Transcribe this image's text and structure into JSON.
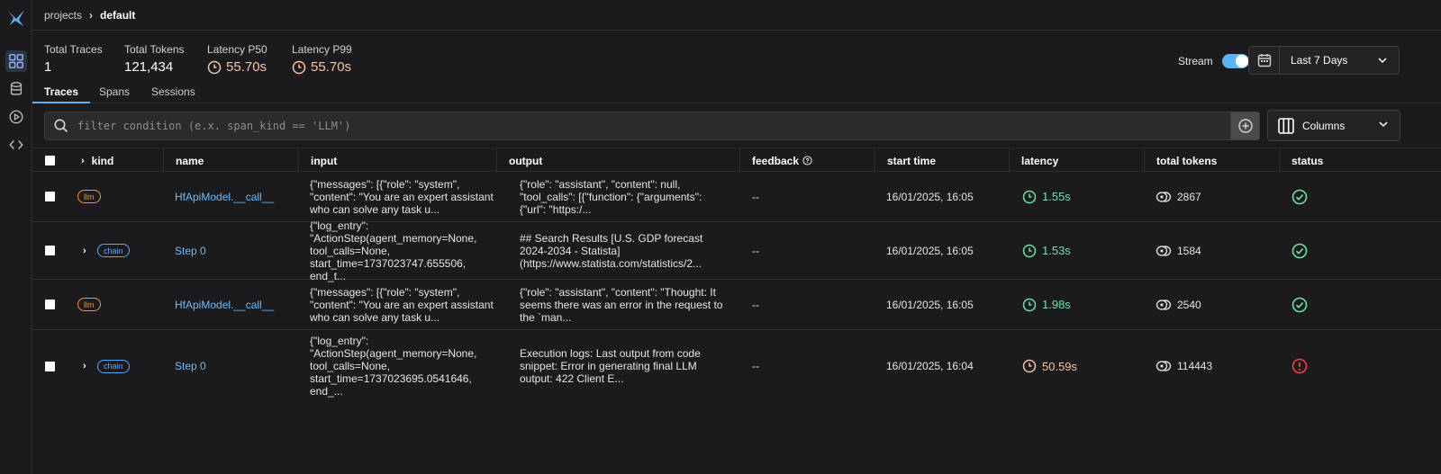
{
  "breadcrumb": {
    "parent": "projects",
    "current": "default"
  },
  "stats": [
    {
      "label": "Total Traces",
      "value": "1"
    },
    {
      "label": "Total Tokens",
      "value": "121,434"
    },
    {
      "label": "Latency P50",
      "value": "55.70s"
    },
    {
      "label": "Latency P99",
      "value": "55.70s"
    }
  ],
  "stream": {
    "label": "Stream",
    "enabled": true
  },
  "time_range": {
    "value": "Last 7 Days"
  },
  "tabs": [
    {
      "label": "Traces",
      "active": true
    },
    {
      "label": "Spans",
      "active": false
    },
    {
      "label": "Sessions",
      "active": false
    }
  ],
  "filter": {
    "placeholder": "filter condition (e.x. span_kind == 'LLM')"
  },
  "columns_button": {
    "label": "Columns"
  },
  "table": {
    "headers": {
      "kind": "kind",
      "name": "name",
      "input": "input",
      "output": "output",
      "feedback": "feedback",
      "start_time": "start time",
      "latency": "latency",
      "total_tokens": "total tokens",
      "status": "status"
    },
    "rows": [
      {
        "kind": "llm",
        "expandable": false,
        "name": "HfApiModel.__call__",
        "input": "{\"messages\": [{\"role\": \"system\", \"content\": \"You are an expert assistant who can solve any task u...",
        "output": "{\"role\": \"assistant\", \"content\": null, \"tool_calls\": [{\"function\": {\"arguments\": {\"url\": \"https:/...",
        "feedback": "--",
        "start_time": "16/01/2025, 16:05",
        "latency": "1.55s",
        "latency_state": "ok",
        "total_tokens": "2867",
        "status": "ok"
      },
      {
        "kind": "chain",
        "expandable": true,
        "name": "Step 0",
        "input": "{\"log_entry\": \"ActionStep(agent_memory=None, tool_calls=None, start_time=1737023747.655506, end_t...",
        "output": "## Search Results [U.S. GDP forecast 2024-2034 - Statista] (https://www.statista.com/statistics/2...",
        "feedback": "--",
        "start_time": "16/01/2025, 16:05",
        "latency": "1.53s",
        "latency_state": "ok",
        "total_tokens": "1584",
        "status": "ok"
      },
      {
        "kind": "llm",
        "expandable": false,
        "name": "HfApiModel.__call__",
        "input": "{\"messages\": [{\"role\": \"system\", \"content\": \"You are an expert assistant who can solve any task u...",
        "output": "{\"role\": \"assistant\", \"content\": \"Thought: It seems there was an error in the request to the `man...",
        "feedback": "--",
        "start_time": "16/01/2025, 16:05",
        "latency": "1.98s",
        "latency_state": "ok",
        "total_tokens": "2540",
        "status": "ok"
      },
      {
        "kind": "chain",
        "expandable": true,
        "name": "Step 0",
        "input": "{\"log_entry\": \"ActionStep(agent_memory=None, tool_calls=None, start_time=1737023695.0541646, end_...",
        "output": "Execution logs: Last output from code snippet: Error in generating final LLM output: 422 Client E...",
        "feedback": "--",
        "start_time": "16/01/2025, 16:04",
        "latency": "50.59s",
        "latency_state": "warn",
        "total_tokens": "114443",
        "status": "error"
      }
    ]
  },
  "colors": {
    "accent": "#58b4f4",
    "ok": "#6ee2a4",
    "warn": "#f3c6a8",
    "error": "#f0443c",
    "llm": "#e89a3c",
    "chain": "#58a8ff"
  }
}
